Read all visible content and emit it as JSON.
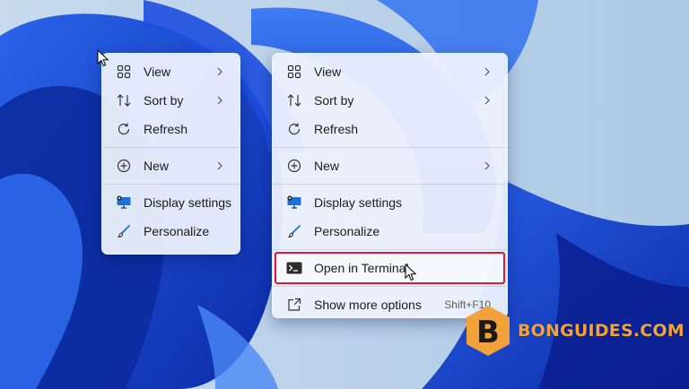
{
  "colors": {
    "wallpaper_light": "#bcd3e9",
    "wallpaper_blue": "#1a4fd8",
    "wallpaper_dark": "#0a1f8f",
    "menu_bg": "#ecf1fc",
    "highlight_border": "#e3182d",
    "watermark_orange": "#f2a23a"
  },
  "menu_short": {
    "items": [
      {
        "label": "View",
        "icon": "view-grid-icon",
        "submenu": true
      },
      {
        "label": "Sort by",
        "icon": "sort-icon",
        "submenu": true
      },
      {
        "label": "Refresh",
        "icon": "refresh-icon",
        "submenu": false
      },
      {
        "label": "New",
        "icon": "plus-circle-icon",
        "submenu": true
      },
      {
        "label": "Display settings",
        "icon": "display-icon",
        "submenu": false
      },
      {
        "label": "Personalize",
        "icon": "brush-icon",
        "submenu": false
      }
    ]
  },
  "menu_full": {
    "items": [
      {
        "label": "View",
        "icon": "view-grid-icon",
        "submenu": true
      },
      {
        "label": "Sort by",
        "icon": "sort-icon",
        "submenu": true
      },
      {
        "label": "Refresh",
        "icon": "refresh-icon",
        "submenu": false
      },
      {
        "label": "New",
        "icon": "plus-circle-icon",
        "submenu": true
      },
      {
        "label": "Display settings",
        "icon": "display-icon",
        "submenu": false
      },
      {
        "label": "Personalize",
        "icon": "brush-icon",
        "submenu": false
      },
      {
        "label": "Open in Terminal",
        "icon": "terminal-icon",
        "submenu": false,
        "selected": true
      },
      {
        "label": "Show more options",
        "icon": "show-more-icon",
        "shortcut": "Shift+F10"
      }
    ]
  },
  "watermark": {
    "text": "BONGUIDES.COM",
    "logo_letter": "B"
  }
}
